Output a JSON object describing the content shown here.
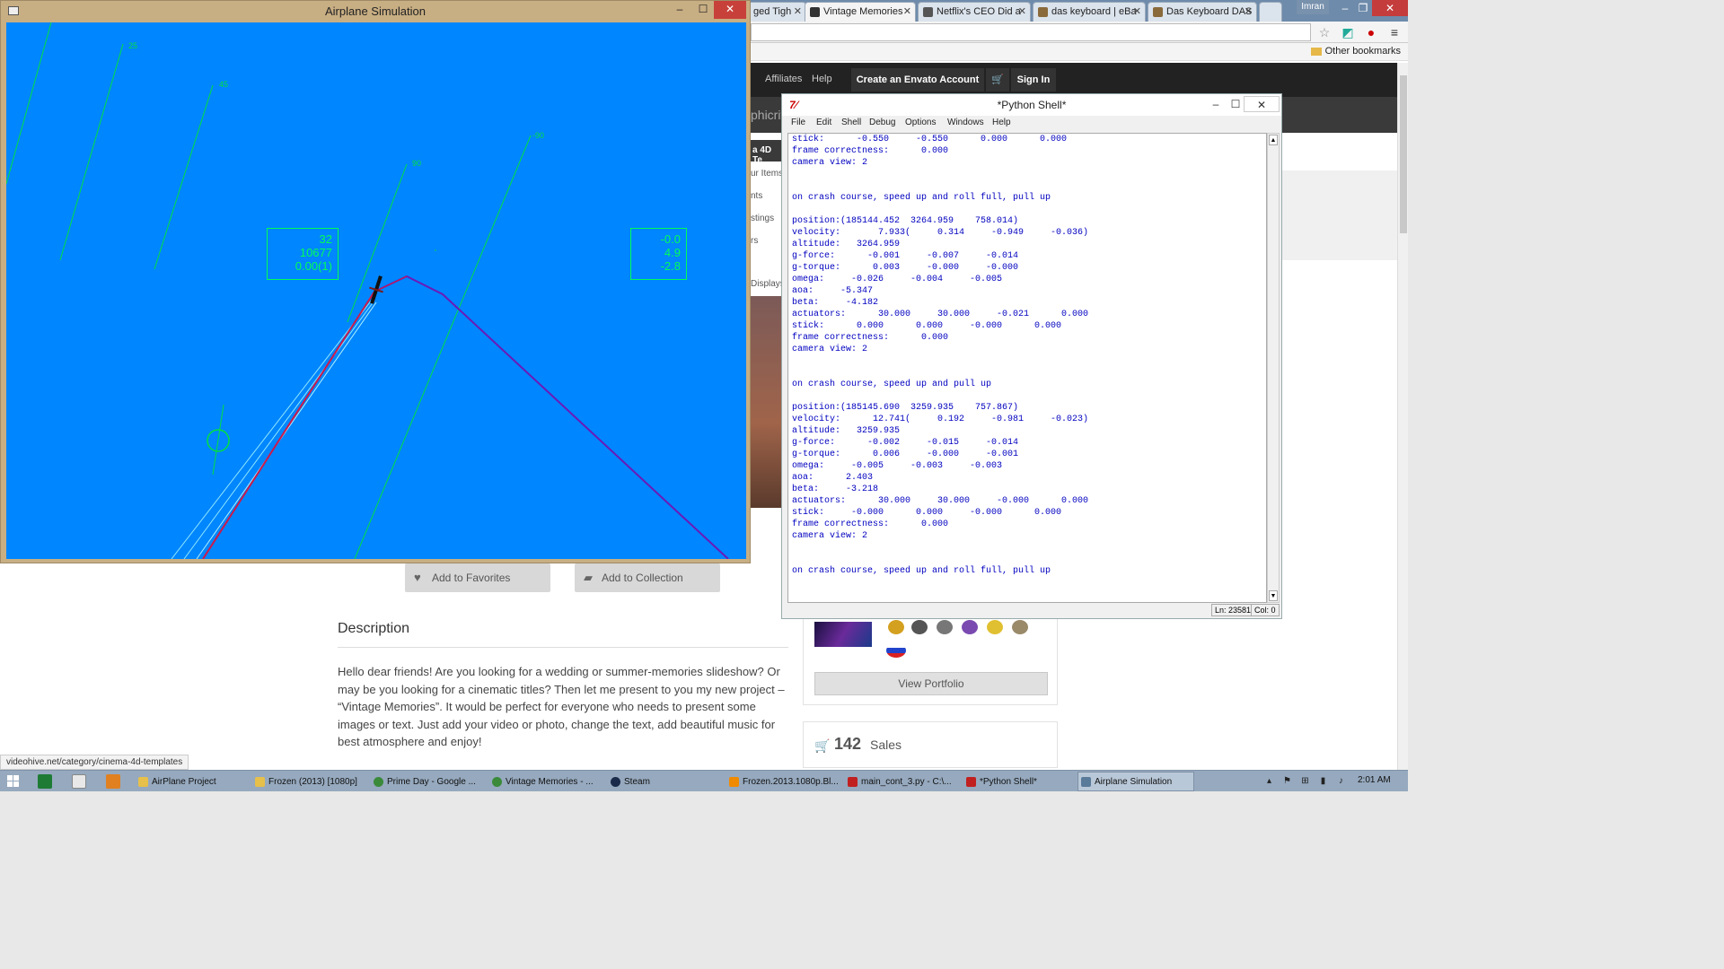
{
  "browser": {
    "tabs": [
      {
        "label": "ged Tigh",
        "icon": "page-icon",
        "active": false
      },
      {
        "label": "Vintage Memories",
        "icon": "envato-icon",
        "active": true
      },
      {
        "label": "Netflix's CEO Did a",
        "icon": "page-icon",
        "active": false
      },
      {
        "label": "das keyboard | eBa",
        "icon": "page-icon",
        "active": false
      },
      {
        "label": "Das Keyboard DAS",
        "icon": "page-icon",
        "active": false
      }
    ],
    "user_label": "Imran",
    "other_bookmarks": "Other bookmarks",
    "status_url": "videohive.net/category/cinema-4d-templates"
  },
  "site": {
    "nav": {
      "affiliates": "Affiliates",
      "help": "Help",
      "create_account": "Create an Envato Account",
      "sign_in": "Sign In"
    },
    "sub_title": "phicrit",
    "side_strip": "a 4D Te",
    "side_links": [
      "ur Items",
      "nts",
      "stings",
      "rs",
      "Displays"
    ],
    "buttons": {
      "add_favorites": "Add to Favorites",
      "add_collection": "Add to Collection"
    },
    "description_title": "Description",
    "description_body": "Hello dear friends! Are you looking for a wedding or summer-memories slideshow? Or may be you looking for a cinematic titles? Then let me present to you my new project – “Vintage Memories”. It would be perfect for everyone who needs to present some images or text. Just add your video or photo, change the text, add beautiful music for best atmosphere and enjoy!",
    "view_portfolio": "View Portfolio",
    "sales_count": "142",
    "sales_label": "Sales"
  },
  "sim": {
    "title": "Airplane Simulation",
    "hud_left": [
      "32",
      "10677",
      "0.00(1)"
    ],
    "hud_right": [
      "-0.0",
      "4.9",
      "-2.8"
    ],
    "pitch_labels": [
      "25",
      "45",
      "90",
      "-90"
    ],
    "colors": {
      "sky": "#0086fe",
      "hud": "#00ff55"
    }
  },
  "python_shell": {
    "title": "*Python Shell*",
    "menu": [
      "File",
      "Edit",
      "Shell",
      "Debug",
      "Options",
      "Windows",
      "Help"
    ],
    "lines": [
      "stick:      -0.550     -0.550      0.000      0.000",
      "frame correctness:      0.000",
      "camera view: 2",
      "",
      "",
      "on crash course, speed up and roll full, pull up",
      "",
      "position:(185144.452  3264.959    758.014)",
      "velocity:       7.933(     0.314     -0.949     -0.036)",
      "altitude:   3264.959",
      "g-force:      -0.001     -0.007     -0.014",
      "g-torque:      0.003     -0.000     -0.000",
      "omega:     -0.026     -0.004     -0.005",
      "aoa:     -5.347",
      "beta:     -4.182",
      "actuators:      30.000     30.000     -0.021      0.000",
      "stick:      0.000      0.000     -0.000      0.000",
      "frame correctness:      0.000",
      "camera view: 2",
      "",
      "",
      "on crash course, speed up and pull up",
      "",
      "position:(185145.690  3259.935    757.867)",
      "velocity:      12.741(     0.192     -0.981     -0.023)",
      "altitude:   3259.935",
      "g-force:      -0.002     -0.015     -0.014",
      "g-torque:      0.006     -0.000     -0.001",
      "omega:     -0.005     -0.003     -0.003",
      "aoa:      2.403",
      "beta:     -3.218",
      "actuators:      30.000     30.000     -0.000      0.000",
      "stick:     -0.000      0.000     -0.000      0.000",
      "frame correctness:      0.000",
      "camera view: 2",
      "",
      "",
      "on crash course, speed up and roll full, pull up"
    ],
    "status_ln": "Ln: 23581",
    "status_col": "Col: 0"
  },
  "taskbar": {
    "items": [
      {
        "label": "AirPlane Project",
        "icon": "folder-icon",
        "active": false
      },
      {
        "label": "Frozen (2013) [1080p]",
        "icon": "folder-icon",
        "active": false
      },
      {
        "label": "Prime Day - Google ...",
        "icon": "chrome-icon",
        "active": false
      },
      {
        "label": "Vintage Memories - ...",
        "icon": "chrome-icon",
        "active": false
      },
      {
        "label": "Steam",
        "icon": "steam-icon",
        "active": false
      },
      {
        "label": "Frozen.2013.1080p.Bl...",
        "icon": "vlc-icon",
        "active": false
      },
      {
        "label": "main_cont_3.py - C:\\...",
        "icon": "idle-icon",
        "active": false
      },
      {
        "label": "*Python Shell*",
        "icon": "idle-icon",
        "active": false
      },
      {
        "label": "Airplane Simulation",
        "icon": "window-icon",
        "active": true
      }
    ],
    "clock": "2:01 AM"
  }
}
